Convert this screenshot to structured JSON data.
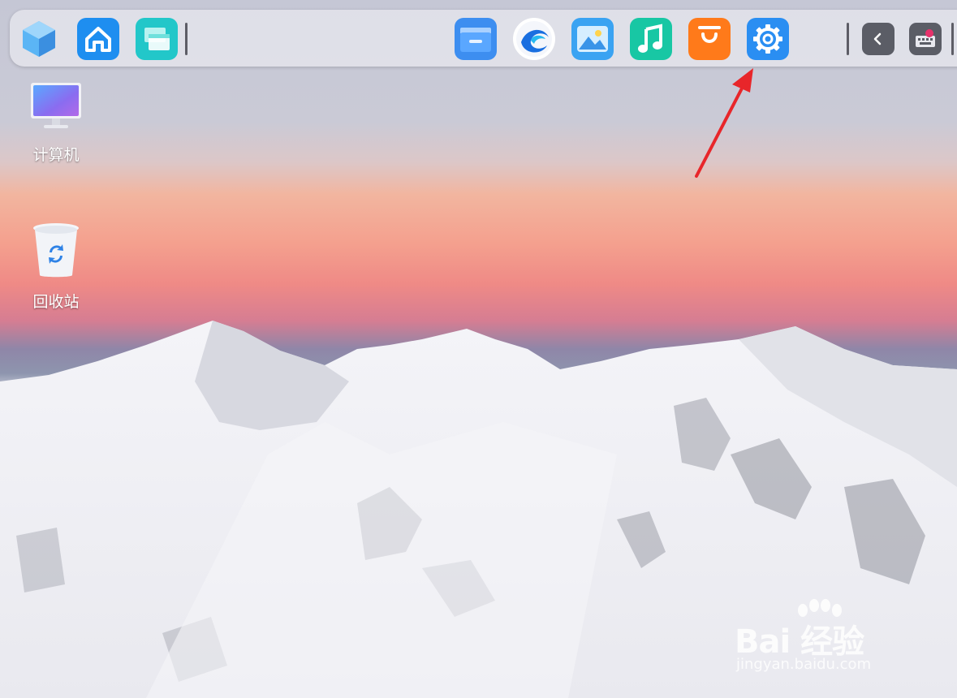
{
  "desktop": {
    "icons": [
      {
        "label": "计算机",
        "icon": "computer-icon"
      },
      {
        "label": "回收站",
        "icon": "recycle-bin-icon"
      }
    ]
  },
  "dock": {
    "apps": [
      {
        "icon": "launcher-cube-icon",
        "color": "#4aa8f0"
      },
      {
        "icon": "home-icon",
        "color": "#1e8ef0"
      },
      {
        "icon": "multitask-view-icon",
        "color": "#22c7c9"
      },
      {
        "icon": "file-manager-icon",
        "color": "#3d8ef0"
      },
      {
        "icon": "browser-icon",
        "color": "#1a6fe0"
      },
      {
        "icon": "image-viewer-icon",
        "color": "#3aa3f2"
      },
      {
        "icon": "music-icon",
        "color": "#18c7a4"
      },
      {
        "icon": "app-store-icon",
        "color": "#ff7a1a"
      },
      {
        "icon": "settings-gear-icon",
        "color": "#2a8ef2"
      }
    ],
    "tray": [
      {
        "icon": "chevron-left-icon"
      },
      {
        "icon": "keyboard-input-icon"
      }
    ]
  },
  "annotation": {
    "icon": "red-arrow-icon",
    "color": "#e8262a"
  },
  "watermark": {
    "brand": "Bai 经验",
    "url": "jingyan.baidu.com"
  }
}
